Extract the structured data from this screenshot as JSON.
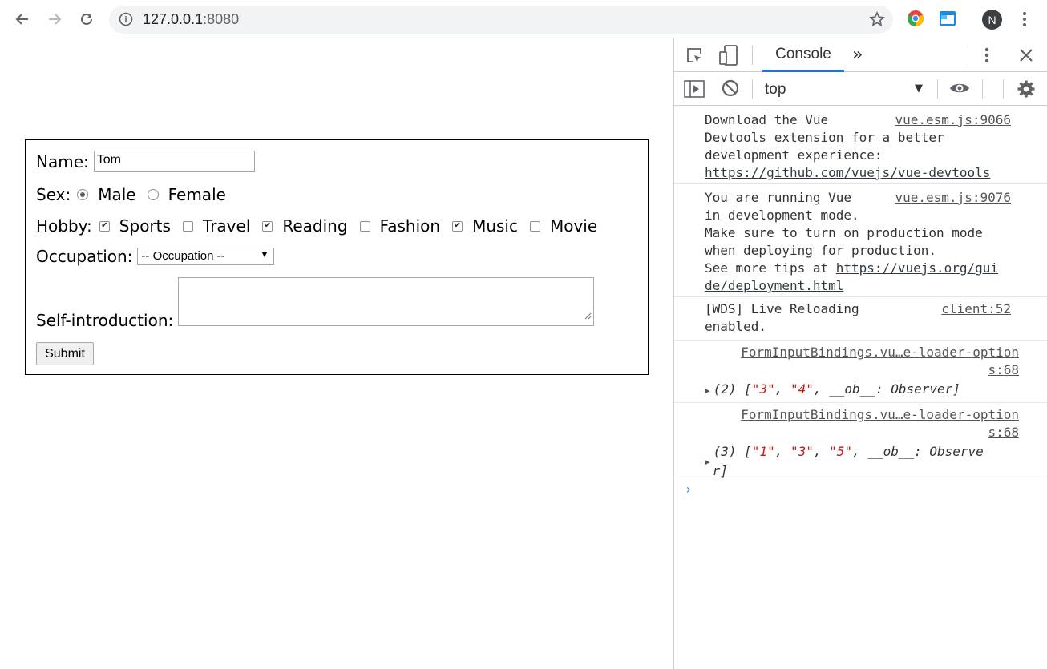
{
  "browser": {
    "url_host": "127.0.0.1",
    "url_port": ":8080",
    "avatar_letter": "N"
  },
  "form": {
    "name_label": "Name:",
    "name_value": "Tom",
    "sex_label": "Sex:",
    "sex_options": [
      "Male",
      "Female"
    ],
    "sex_selected": "Male",
    "hobby_label": "Hobby:",
    "hobbies": [
      {
        "label": "Sports",
        "checked": true
      },
      {
        "label": "Travel",
        "checked": false
      },
      {
        "label": "Reading",
        "checked": true
      },
      {
        "label": "Fashion",
        "checked": false
      },
      {
        "label": "Music",
        "checked": true
      },
      {
        "label": "Movie",
        "checked": false
      }
    ],
    "occupation_label": "Occupation:",
    "occupation_selected": "-- Occupation --",
    "intro_label": "Self-introduction:",
    "intro_value": "",
    "submit_label": "Submit"
  },
  "devtools": {
    "active_tab": "Console",
    "more_tabs": "»",
    "context": "top",
    "messages": {
      "m1_lines": "Download the Vue\nDevtools extension for a better\ndevelopment experience:",
      "m1_link": "https://github.com/vuejs/vue-devtools",
      "m1_source": "vue.esm.js:9066",
      "m2_lines": "You are running Vue\nin development mode.\nMake sure to turn on production mode\nwhen deploying for production.\nSee more tips at ",
      "m2_link1": "https://vuejs.org/gui",
      "m2_link2": "de/deployment.html",
      "m2_source": "vue.esm.js:9076",
      "m3_lines": "[WDS] Live Reloading\nenabled.",
      "m3_source": "client:52",
      "m4_source_line1": "FormInputBindings.vu…e-loader-option",
      "m4_source_line2": "s:68",
      "m4_count": "(2)",
      "m4_items": [
        "\"3\"",
        "\"4\""
      ],
      "m4_tail": "__ob__: Observer]",
      "m5_source_line1": "FormInputBindings.vu…e-loader-option",
      "m5_source_line2": "s:68",
      "m5_count": "(3)",
      "m5_items": [
        "\"1\"",
        "\"3\"",
        "\"5\""
      ],
      "m5_tail1": "__ob__: Observe",
      "m5_tail2": "r]"
    },
    "prompt": "›"
  },
  "colors": {
    "accent": "#1a73e8",
    "string": "#c41a16"
  }
}
